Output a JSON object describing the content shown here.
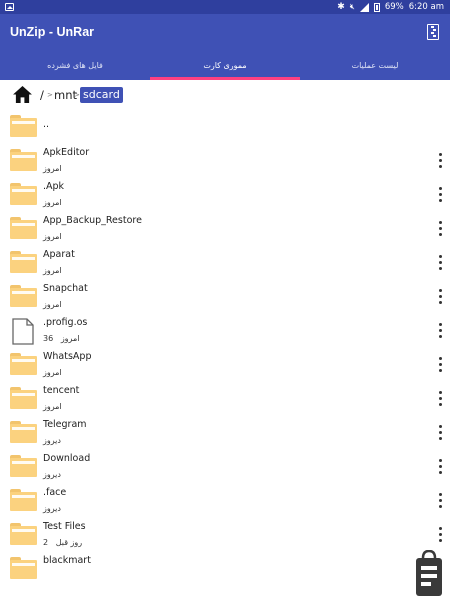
{
  "status_bar": {
    "battery": "69%",
    "time": "6:20 am",
    "icons": [
      "image-icon",
      "bluetooth-icon",
      "mute-icon",
      "signal-icon",
      "battery-icon"
    ]
  },
  "app": {
    "title": "UnZip - UnRar",
    "action_icon": "archive-icon"
  },
  "tabs": [
    {
      "label": "فایل های فشرده"
    },
    {
      "label": "مموری کارت"
    },
    {
      "label": "لیست عملیات"
    }
  ],
  "selected_tab": 1,
  "colors": {
    "primary": "#3f51b5",
    "status_bar": "#2f3f9e",
    "accent": "#ff4081",
    "folder": "#fbd27f"
  },
  "breadcrumb": {
    "root": "/",
    "parts": [
      "mnt",
      "sdcard"
    ],
    "separator": ">"
  },
  "files": [
    {
      "name": "..",
      "meta": "",
      "type": "parent"
    },
    {
      "name": "ApkEditor",
      "meta": "امروز",
      "type": "folder"
    },
    {
      "name": ".Apk",
      "meta": "امروز",
      "type": "folder"
    },
    {
      "name": "App_Backup_Restore",
      "meta": "امروز",
      "type": "folder"
    },
    {
      "name": "Aparat",
      "meta": "امروز",
      "type": "folder"
    },
    {
      "name": "Snapchat",
      "meta": "امروز",
      "type": "folder"
    },
    {
      "name": ".profig.os",
      "meta": "36   امروز",
      "type": "file"
    },
    {
      "name": "WhatsApp",
      "meta": "امروز",
      "type": "folder"
    },
    {
      "name": "tencent",
      "meta": "امروز",
      "type": "folder"
    },
    {
      "name": "Telegram",
      "meta": "دیروز",
      "type": "folder"
    },
    {
      "name": "Download",
      "meta": "دیروز",
      "type": "folder"
    },
    {
      "name": ".face",
      "meta": "دیروز",
      "type": "folder"
    },
    {
      "name": "Test Files",
      "meta": "2   روز قبل",
      "type": "folder"
    },
    {
      "name": "blackmart",
      "meta": "",
      "type": "folder"
    }
  ]
}
